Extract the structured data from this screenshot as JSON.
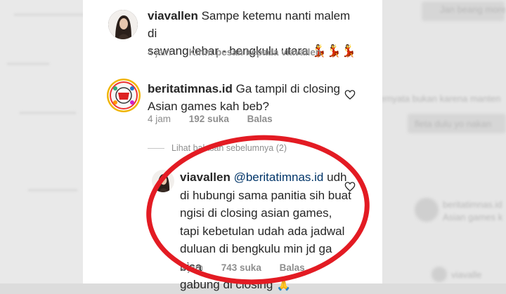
{
  "comments": [
    {
      "username": "viavallen",
      "text_line1": "Sampe ketemu nanti malem di",
      "text_line2": "sawang lebar - bengkulu utara",
      "emoji": "💃💃💃",
      "time": "4 jam",
      "action": "Kirim pesan kepada viavallen"
    },
    {
      "username": "beritatimnas.id",
      "text_line1": "Ga tampil di closing",
      "text_line2": "Asian games kah beb?",
      "time": "4 jam",
      "likes": "192 suka",
      "action": "Balas"
    }
  ],
  "replies_toggle": "Lihat balasan sebelumnya (2)",
  "reply": {
    "username": "viavallen",
    "mention": "@beritatimnas.id",
    "text_line1": "udh",
    "text_line2": "di hubungi sama panitia sih buat",
    "text_line3": "ngisi di closing asian games,",
    "text_line4": "tapi kebetulan udah ada jadwal",
    "text_line5": "duluan di bengkulu min jd ga bisa",
    "text_line6": "gabung di closing",
    "emoji": "🙏",
    "time": "4 jam",
    "likes": "743 suka",
    "action": "Balas"
  },
  "background": {
    "right_1": "Jan beang more",
    "right_2": "ternyata bukan karena manten",
    "right_3": "fleta dulu yo nakan",
    "right_4": "beritatimnas.id",
    "right_5": "Asian games k",
    "right_6": "viavalle"
  },
  "colors": {
    "highlight_ring": "#e31b23",
    "mention": "#003569"
  }
}
